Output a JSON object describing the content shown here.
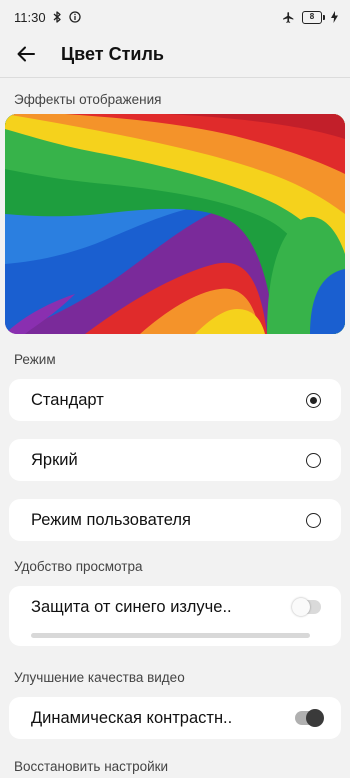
{
  "status_bar": {
    "time": "11:30",
    "battery_level": "8",
    "icons": [
      "bluetooth-icon",
      "info-icon",
      "airplane-icon",
      "battery-icon",
      "charging-icon"
    ]
  },
  "app_bar": {
    "title": "Цвет Стиль",
    "back_icon": "back-arrow-icon"
  },
  "preview": {
    "label": "Эффекты отображения",
    "stripe_colors": [
      "#7a2a9a",
      "#1a5fd0",
      "#1e9e3e",
      "#f5d21c",
      "#f4932a",
      "#e02b2b",
      "#8a2fb0"
    ]
  },
  "mode": {
    "label": "Режим",
    "options": [
      {
        "label": "Стандарт",
        "selected": true
      },
      {
        "label": "Яркий",
        "selected": false
      },
      {
        "label": "Режим пользователя",
        "selected": false
      }
    ]
  },
  "viewing_comfort": {
    "label": "Удобство просмотра",
    "blue_light": {
      "label": "Защита от синего излуче..",
      "enabled": false
    }
  },
  "video_enhancement": {
    "label": "Улучшение качества видео",
    "dynamic_contrast": {
      "label": "Динамическая контрастн..",
      "enabled": true
    }
  },
  "restore": {
    "label": "Восстановить настройки"
  }
}
